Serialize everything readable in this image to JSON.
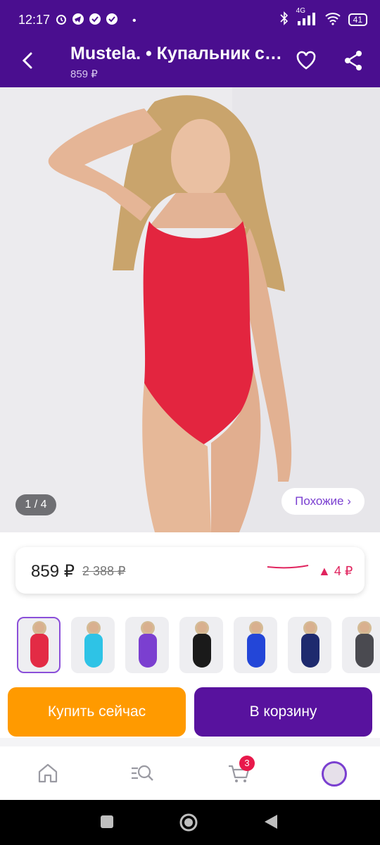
{
  "status_bar": {
    "time": "12:17",
    "network": "4G",
    "battery": "41"
  },
  "app_bar": {
    "title": "Mustela. • Купальник слитный",
    "subtitle_price": "859 ₽"
  },
  "hero": {
    "counter": "1 / 4",
    "similar_label": "Похожие ›",
    "image_subject": "model in red one-piece swimsuit"
  },
  "price_card": {
    "price": "859 ₽",
    "old_price": "2 388 ₽",
    "change": "▲ 4 ₽"
  },
  "thumbnails": [
    {
      "color": "#e32b45",
      "active": true
    },
    {
      "color": "#2ec3e6",
      "active": false
    },
    {
      "color": "#7b3fd0",
      "active": false
    },
    {
      "color": "#1a1a1a",
      "active": false
    },
    {
      "color": "#2346d8",
      "active": false
    },
    {
      "color": "#1e2a6e",
      "active": false
    },
    {
      "color": "#4a4a50",
      "active": false
    }
  ],
  "actions": {
    "buy_now": "Купить сейчас",
    "add_to_cart": "В корзину"
  },
  "bottom_nav": {
    "cart_badge": "3"
  },
  "colors": {
    "brand": "#4a0e8f",
    "accent_orange": "#ff9a00",
    "accent_purple": "#58129e",
    "alert": "#e0245e"
  }
}
